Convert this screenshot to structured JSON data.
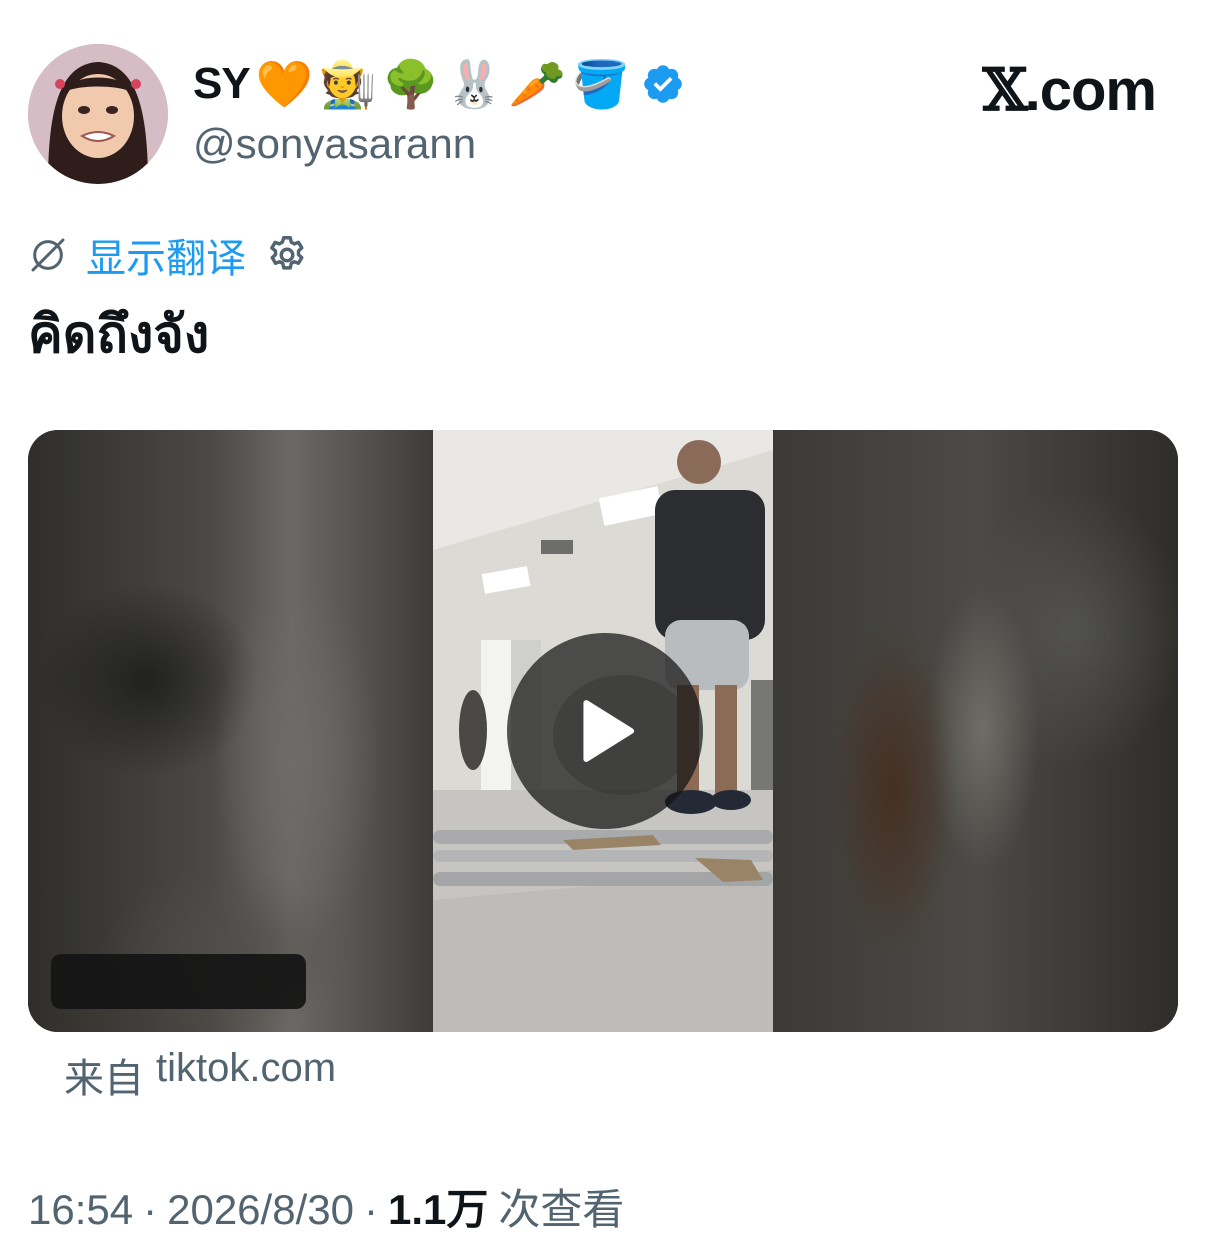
{
  "author": {
    "name": "SY",
    "name_emojis": [
      "🧡",
      "🧑‍🌾",
      "🌳",
      "🐰",
      "🥕",
      "🪣"
    ],
    "handle": "@sonyasarann",
    "verified": true,
    "avatar_icon": "profile-photo"
  },
  "brand": {
    "x_glyph": "𝕏",
    "suffix": ".com"
  },
  "translate": {
    "label": "显示翻译"
  },
  "tweet": {
    "text": "คิดถึงจัง"
  },
  "media": {
    "type": "video",
    "play_icon": "play-icon"
  },
  "source": {
    "prefix": "来自",
    "domain": "tiktok.com"
  },
  "meta": {
    "time": "16:54",
    "sep1": "·",
    "date": "2026/8/30",
    "sep2": "·",
    "views_count": "1.1万",
    "views_label": "次查看"
  },
  "colors": {
    "accent": "#1d9bf0",
    "secondary_text": "#536471",
    "primary_text": "#0f1419"
  }
}
